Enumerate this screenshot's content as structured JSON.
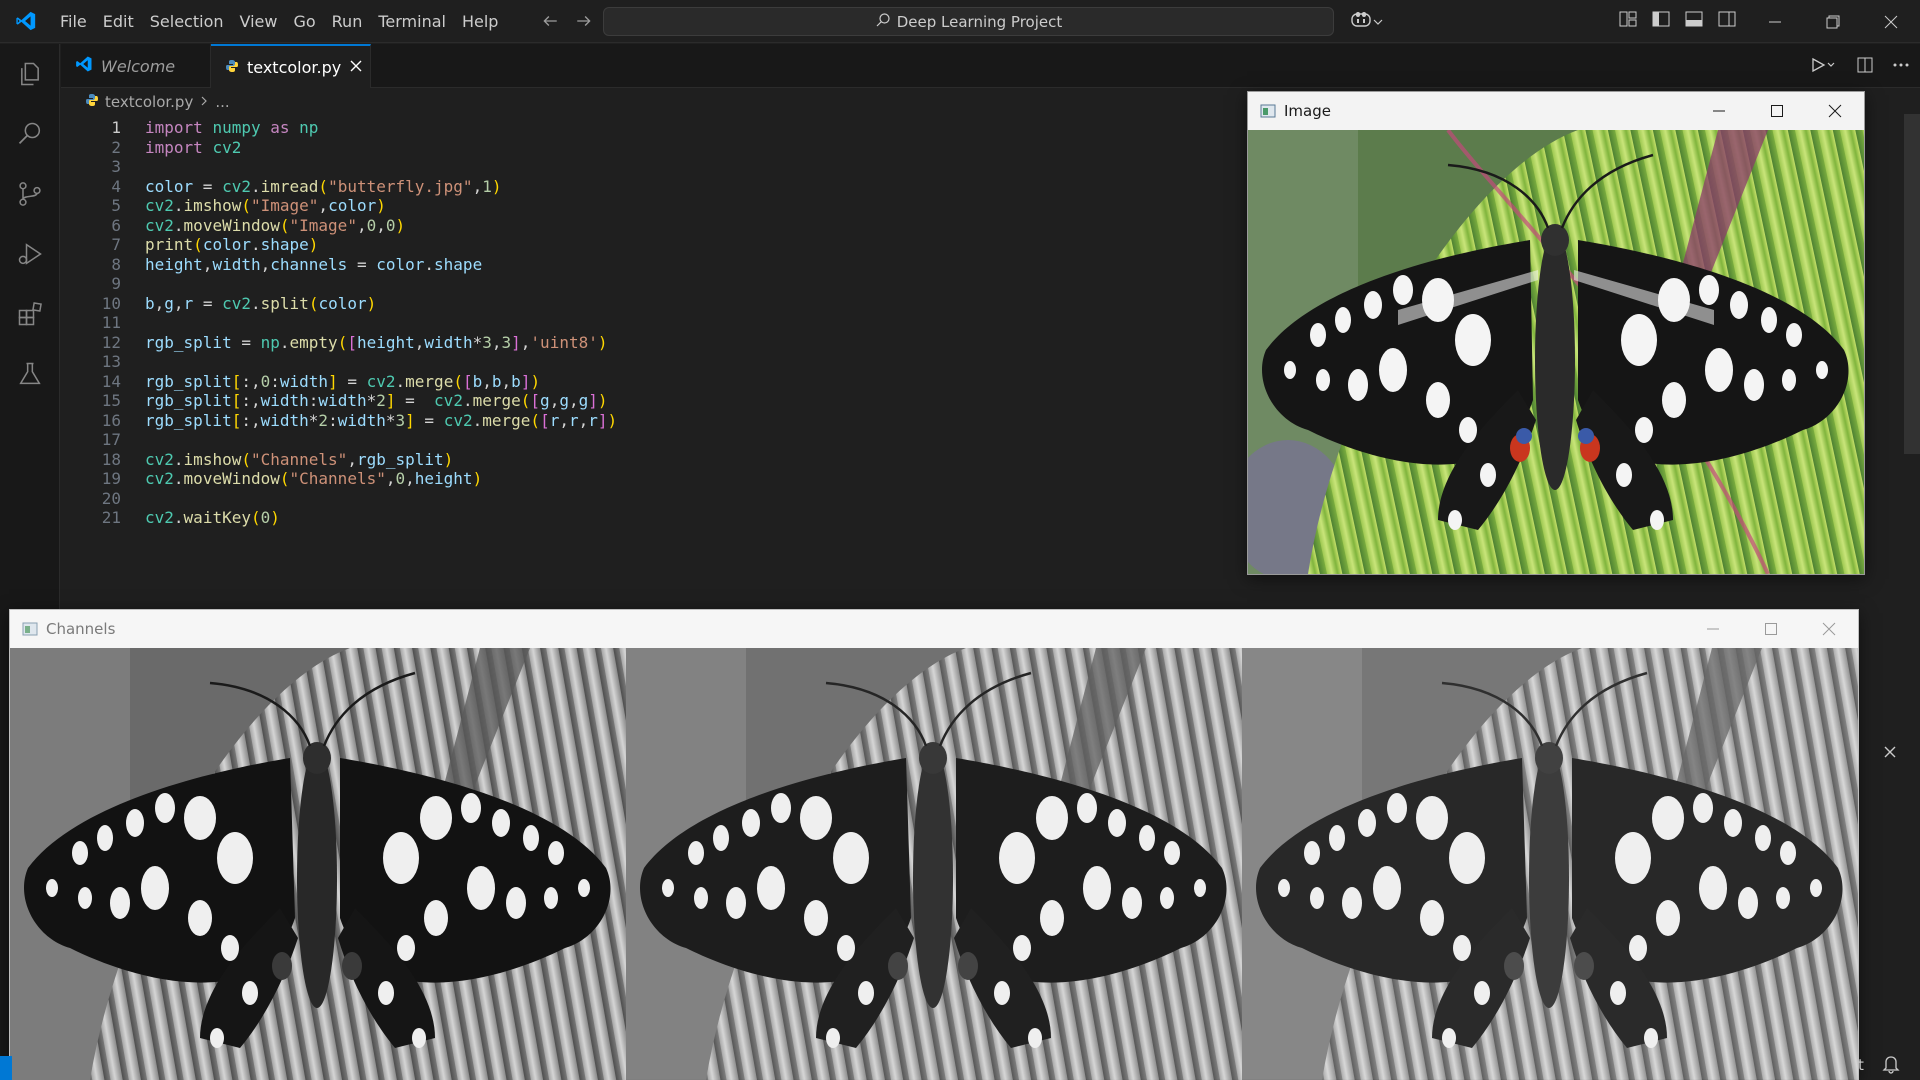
{
  "menubar": {
    "items": [
      "File",
      "Edit",
      "Selection",
      "View",
      "Go",
      "Run",
      "Terminal",
      "Help"
    ],
    "search_text": "Deep Learning Project"
  },
  "tabs": [
    {
      "label": "Welcome",
      "active": false
    },
    {
      "label": "textcolor.py",
      "active": true
    }
  ],
  "breadcrumb": {
    "file": "textcolor.py",
    "more": "..."
  },
  "editor": {
    "language": "python",
    "current_line": 1,
    "lines": [
      "import numpy as np",
      "import cv2",
      "",
      "color = cv2.imread(\"butterfly.jpg\",1)",
      "cv2.imshow(\"Image\",color)",
      "cv2.moveWindow(\"Image\",0,0)",
      "print(color.shape)",
      "height,width,channels = color.shape",
      "",
      "b,g,r = cv2.split(color)",
      "",
      "rgb_split = np.empty([height,width*3,3],'uint8')",
      "",
      "rgb_split[:,0:width] = cv2.merge([b,b,b])",
      "rgb_split[:,width:width*2] =  cv2.merge([g,g,g])",
      "rgb_split[:,width*2:width*3] = cv2.merge([r,r,r])",
      "",
      "cv2.imshow(\"Channels\",rgb_split)",
      "cv2.moveWindow(\"Channels\",0,height)",
      "",
      "cv2.waitKey(0)"
    ]
  },
  "image_window": {
    "title": "Image",
    "content": "color butterfly on green leaf"
  },
  "channels_window": {
    "title": "Channels",
    "panels": [
      "blue channel",
      "green channel",
      "red channel"
    ]
  },
  "status": {
    "text": "t"
  },
  "colors": {
    "accent": "#0078d4",
    "editor_bg": "#1f1f1f",
    "keyword": "#c586c0",
    "string": "#ce9178"
  }
}
